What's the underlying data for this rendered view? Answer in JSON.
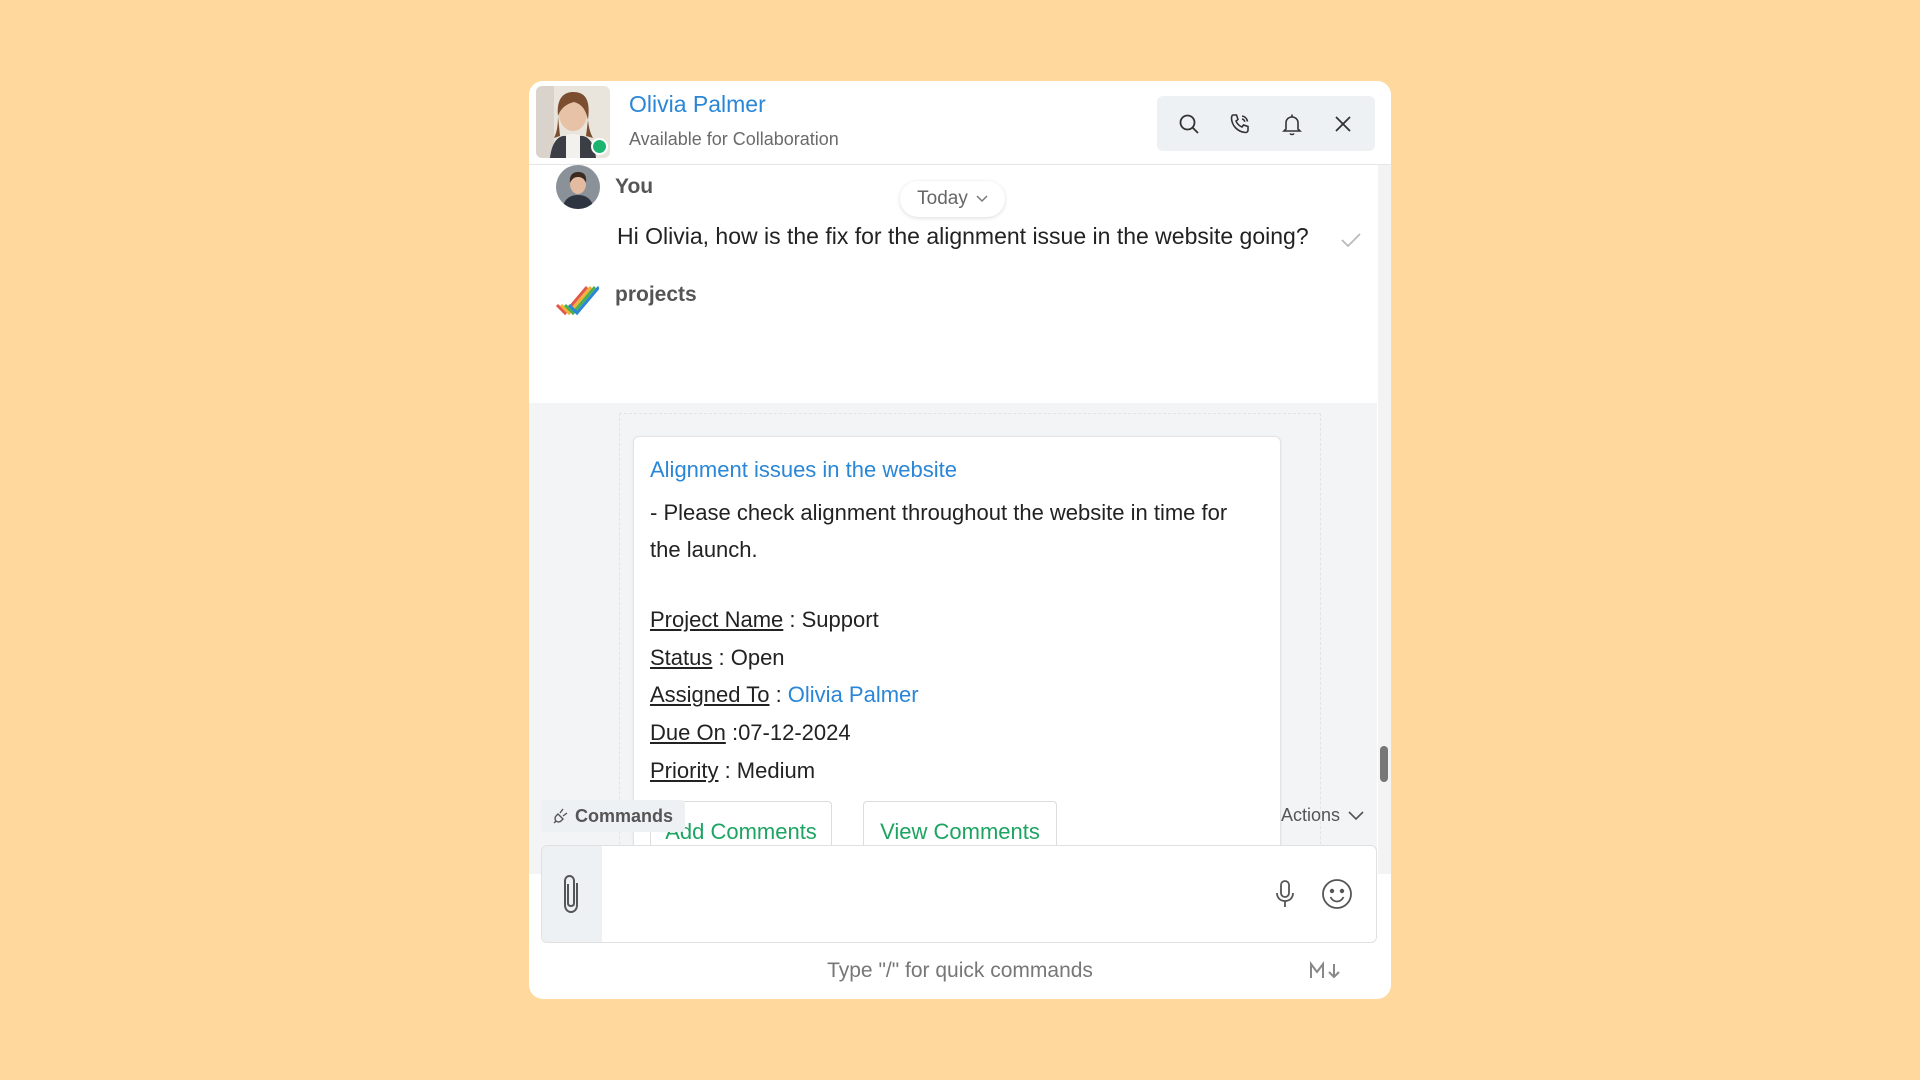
{
  "header": {
    "contact_name": "Olivia Palmer",
    "contact_status": "Available for Collaboration"
  },
  "conversation": {
    "date_divider": "Today",
    "sender_label": "You",
    "message_text": "Hi Olivia, how is the fix for the alignment issue in the website going?",
    "bot_label": "projects"
  },
  "card": {
    "title": "Alignment issues in the website",
    "description": "- Please check alignment throughout the website in time for the launch.",
    "fields": [
      {
        "label": "Project Name",
        "sep": " : ",
        "value": "Support"
      },
      {
        "label": "Status",
        "sep": " : ",
        "value": "Open"
      },
      {
        "label": "Assigned To",
        "sep": " : ",
        "value": "Olivia Palmer"
      },
      {
        "label": "Due On",
        "sep": " :",
        "value": "07-12-2024"
      },
      {
        "label": "Priority",
        "sep": " : ",
        "value": "Medium"
      }
    ],
    "add_comments": "Add Comments",
    "view_comments": "View Comments"
  },
  "composer": {
    "commands_label": "Commands",
    "actions_label": "Actions",
    "hint": "Type \"/\" for quick commands"
  },
  "colors": {
    "background": "#FFD89D",
    "link": "#2A86D6",
    "success": "#1DA462",
    "online": "#1DB46F"
  }
}
